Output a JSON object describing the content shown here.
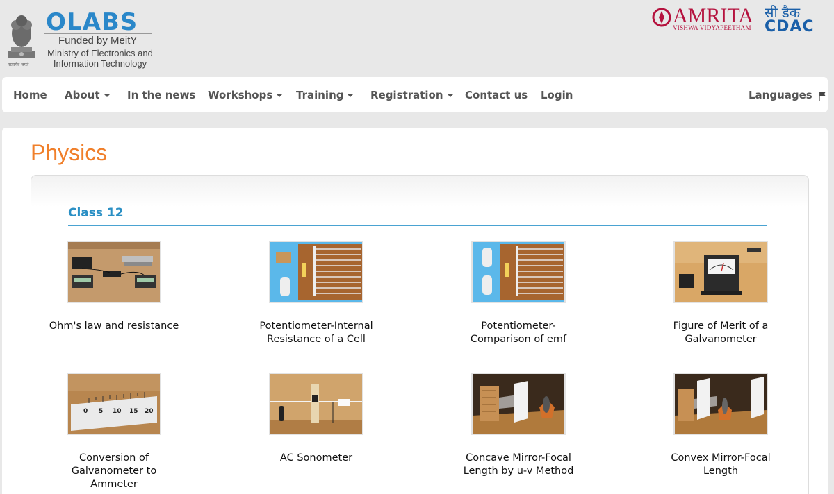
{
  "header": {
    "logo_text": "OLABS",
    "funded_text": "Funded by MeitY",
    "ministry_line1": "Ministry of Electronics and",
    "ministry_line2": "Information Technology",
    "emblem_caption": "सत्यमेव जयते",
    "partner1_name": "AMRITA",
    "partner1_sub": "VISHWA VIDYAPEETHAM",
    "partner2_hindi": "सी डैक",
    "partner2_name": "CDAC"
  },
  "nav": {
    "items": [
      {
        "label": "Home",
        "dropdown": false
      },
      {
        "label": "About",
        "dropdown": true
      },
      {
        "label": "In the news",
        "dropdown": false
      },
      {
        "label": "Workshops",
        "dropdown": true
      },
      {
        "label": "Training",
        "dropdown": true
      },
      {
        "label": "Registration",
        "dropdown": true
      },
      {
        "label": "Contact us",
        "dropdown": false
      },
      {
        "label": "Login",
        "dropdown": false
      }
    ],
    "languages_label": "Languages"
  },
  "page": {
    "title": "Physics",
    "section_title": "Class 12"
  },
  "experiments": [
    {
      "line1": "Ohm's law and resistance",
      "line2": "",
      "line3": "",
      "thumb": "ohms-law-thumbnail"
    },
    {
      "line1": "Potentiometer-Internal",
      "line2": "Resistance of a Cell",
      "line3": "",
      "thumb": "potentiometer-thumbnail"
    },
    {
      "line1": "Potentiometer-",
      "line2": "Comparison of emf",
      "line3": "",
      "thumb": "potentiometer-thumbnail"
    },
    {
      "line1": "Figure of Merit of a",
      "line2": "Galvanometer",
      "line3": "",
      "thumb": "galvanometer-thumbnail"
    },
    {
      "line1": "Conversion of",
      "line2": "Galvanometer to",
      "line3": "Ammeter",
      "thumb": "ruler-thumbnail"
    },
    {
      "line1": "AC Sonometer",
      "line2": "",
      "line3": "",
      "thumb": "sonometer-thumbnail"
    },
    {
      "line1": "Concave Mirror-Focal",
      "line2": "Length by u-v Method",
      "line3": "",
      "thumb": "mirror-bench-thumbnail"
    },
    {
      "line1": "Convex Mirror-Focal",
      "line2": "Length",
      "line3": "",
      "thumb": "mirror-bench-thumbnail"
    }
  ],
  "ruler_labels": [
    "0",
    "5",
    "10",
    "15",
    "20"
  ],
  "colors": {
    "accent_orange": "#f07f2a",
    "section_blue": "#2a8fc4",
    "logo_blue": "#2a87c9",
    "amrita_red": "#b5123e",
    "cdac_blue": "#1a5fa8"
  }
}
